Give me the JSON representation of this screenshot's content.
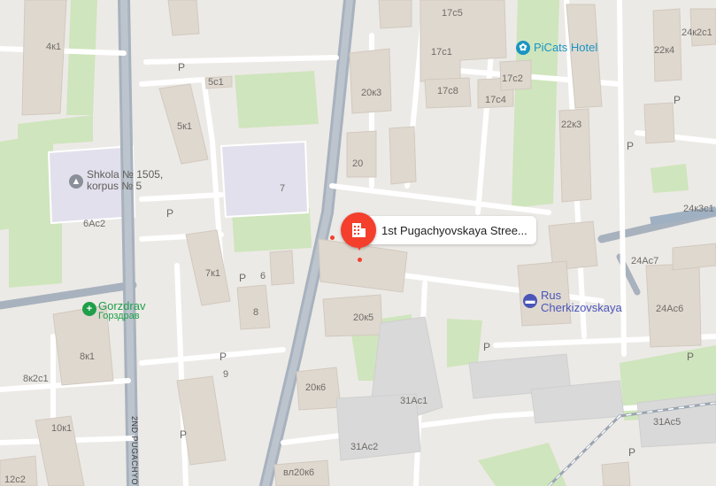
{
  "buildings": [
    "17с5",
    "17с1",
    "17с2",
    "17с8",
    "17с4",
    "4к1",
    "5с1",
    "5к1",
    "20к3",
    "20",
    "7",
    "22к4",
    "24к2с1",
    "22к3",
    "24к3с1",
    "24Ас7",
    "6Ас2",
    "7к1",
    "6",
    "8",
    "20к5",
    "24Ас6",
    "8к1",
    "8к2с1",
    "9",
    "20к6",
    "31Ас1",
    "10к1",
    "31Ас2",
    "31Ас5",
    "12с2",
    "вл20к6"
  ],
  "parking": [
    "P",
    "P",
    "P",
    "P",
    "P",
    "P",
    "P",
    "P",
    "P",
    "P"
  ],
  "pois": {
    "picats": {
      "name": "PiCats Hotel",
      "color": "#1a95c2",
      "icon": "paw-icon"
    },
    "school": {
      "name_line1": "Shkola № 1505,",
      "name_line2": "korpus № 5",
      "icon": "school-icon"
    },
    "gorzdrav": {
      "name": "Gorzdrav",
      "subname": "Горздрав",
      "color": "#1f9f4a",
      "icon": "pharmacy-cross-icon"
    },
    "rus": {
      "name_line1": "Rus",
      "name_line2": "Cherkizovskaya",
      "color": "#4a55b8",
      "icon": "bed-icon"
    }
  },
  "selected": {
    "label": "1st Pugachyovskaya Stree...",
    "color": "#f43f2d",
    "icon": "building-icon"
  },
  "streets": {
    "second_pugachyovskaya": "2ND PUGACHYO"
  }
}
